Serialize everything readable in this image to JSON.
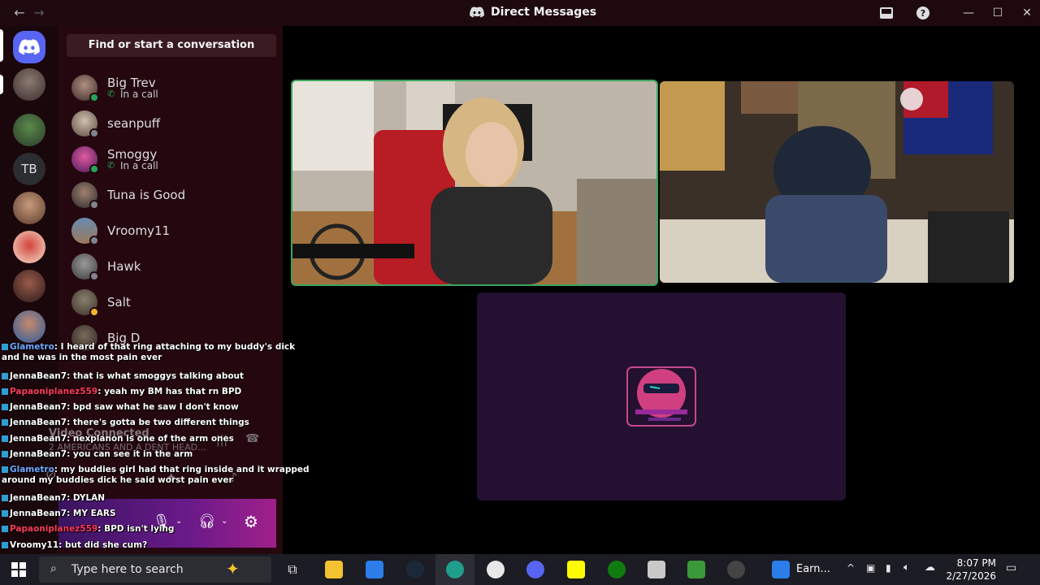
{
  "titlebar": {
    "title": "Direct Messages"
  },
  "dm_sidebar": {
    "search_placeholder": "Find or start a conversation",
    "items": [
      {
        "name": "Big Trev",
        "sub": "In a call",
        "status": "online"
      },
      {
        "name": "seanpuff",
        "sub": "",
        "status": "offline"
      },
      {
        "name": "Smoggy",
        "sub": "In a call",
        "status": "online"
      },
      {
        "name": "Tuna is Good",
        "sub": "",
        "status": "offline"
      },
      {
        "name": "Vroomy11",
        "sub": "",
        "status": "offline"
      },
      {
        "name": "Hawk",
        "sub": "",
        "status": "offline"
      },
      {
        "name": "Salt",
        "sub": "",
        "status": "idle"
      },
      {
        "name": "Big D",
        "sub": "",
        "status": "offline"
      }
    ],
    "rail_text_server": "TB"
  },
  "voice": {
    "status": "Video Connected",
    "channel": "2 AMERICANS AND A DENT HEAD..."
  },
  "chat": [
    {
      "user": "Glametro",
      "text": ": I heard of that ring attaching to my buddy's dick and he was in the most pain ever",
      "user_color": "#6fa8ff"
    },
    {
      "user": "JennaBean7",
      "text": ": that is what smoggys talking about",
      "user_color": "#ffffff"
    },
    {
      "user": "Papaoniplanez559",
      "text": ": yeah my BM has that rn BPD",
      "user_color": "#ff3b5c"
    },
    {
      "user": "JennaBean7",
      "text": ": bpd saw what he saw I don't know",
      "user_color": "#ffffff"
    },
    {
      "user": "JennaBean7",
      "text": ": there's gotta be two different things",
      "user_color": "#ffffff"
    },
    {
      "user": "JennaBean7",
      "text": ": nexplanon is one of the arm ones",
      "user_color": "#ffffff"
    },
    {
      "user": "JennaBean7",
      "text": ": you can see it in the arm",
      "user_color": "#ffffff"
    },
    {
      "user": "Glametro",
      "text": ": my buddies girl had that ring inside and it wrapped around my buddies dick he said worst pain ever",
      "user_color": "#6fa8ff"
    },
    {
      "user": "JennaBean7",
      "text": ": DYLAN",
      "user_color": "#ffffff"
    },
    {
      "user": "JennaBean7",
      "text": ": MY EARS",
      "user_color": "#ffffff"
    },
    {
      "user": "Papaoniplanez559",
      "text": ": BPD isn't lying",
      "user_color": "#ff3b5c"
    },
    {
      "user": "Vroomy11",
      "text": ": but did she cum?",
      "user_color": "#ffffff"
    }
  ],
  "taskbar": {
    "search_placeholder": "Type here to search",
    "open_app_label": "Earn...",
    "time": "8:07 PM",
    "date": "2/27/2026"
  },
  "colors": {
    "online": "#23a55a",
    "idle": "#f0b232",
    "offline": "#80848e",
    "speaking_border": "#3ba55d"
  }
}
